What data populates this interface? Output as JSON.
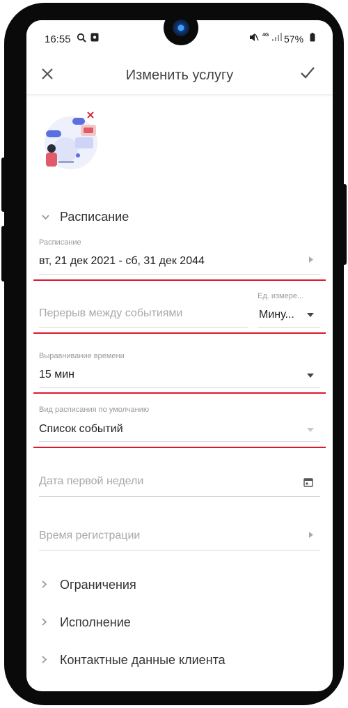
{
  "status": {
    "time": "16:55",
    "network": "4G",
    "battery": "57%"
  },
  "appbar": {
    "title": "Изменить услугу"
  },
  "schedule_section": {
    "label": "Расписание"
  },
  "schedule": {
    "label": "Расписание",
    "value": "вт, 21 дек 2021 - сб, 31 дек 2044"
  },
  "break": {
    "placeholder": "Перерыв между событиями",
    "unit_label": "Ед. измере...",
    "unit_value": "Мину..."
  },
  "alignment": {
    "label": "Выравнивание времени",
    "value": "15 мин"
  },
  "view": {
    "label": "Вид расписания по умолчанию",
    "value": "Список событий"
  },
  "first_week": {
    "placeholder": "Дата первой недели"
  },
  "registration": {
    "placeholder": "Время регистрации"
  },
  "sections": {
    "limits": "Ограничения",
    "execution": "Исполнение",
    "contacts": "Контактные данные клиента"
  },
  "colors": {
    "accent_red": "#e0162b"
  }
}
